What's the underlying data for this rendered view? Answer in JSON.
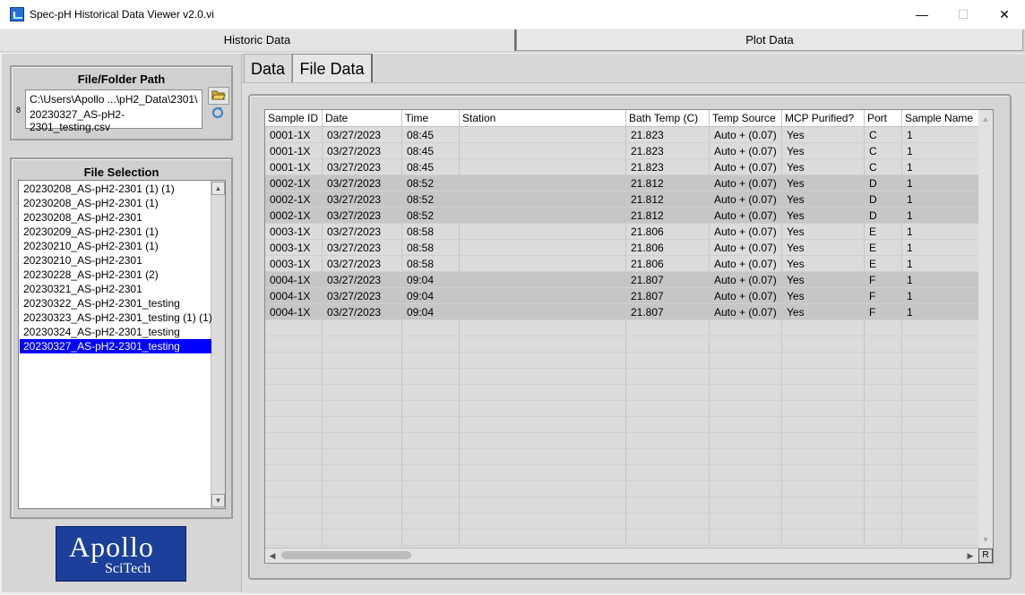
{
  "window": {
    "title": "Spec-pH Historical Data Viewer v2.0.vi",
    "minimize_glyph": "—",
    "maximize_glyph": "☐",
    "close_glyph": "✕"
  },
  "main_tabs": [
    {
      "label": "Historic Data",
      "active": true
    },
    {
      "label": "Plot Data",
      "active": false
    }
  ],
  "file_path": {
    "title": "File/Folder Path",
    "line1": "C:\\Users\\Apollo ...\\pH2_Data\\2301\\",
    "line2": "20230327_AS-pH2-2301_testing.csv",
    "indicator": "8",
    "browse_icon": "folder-open-icon",
    "refresh_icon": "refresh-icon"
  },
  "file_selection": {
    "title": "File Selection",
    "items": [
      "20230208_AS-pH2-2301 (1) (1)",
      "20230208_AS-pH2-2301 (1)",
      "20230208_AS-pH2-2301",
      "20230209_AS-pH2-2301 (1)",
      "20230210_AS-pH2-2301 (1)",
      "20230210_AS-pH2-2301",
      "20230228_AS-pH2-2301 (2)",
      "20230321_AS-pH2-2301",
      "20230322_AS-pH2-2301_testing",
      "20230323_AS-pH2-2301_testing (1) (1)",
      "20230324_AS-pH2-2301_testing",
      "20230327_AS-pH2-2301_testing"
    ],
    "selected_index": 11
  },
  "logo": {
    "line1": "Apollo",
    "line2": "SciTech"
  },
  "sub_tabs": [
    {
      "label": "Data",
      "active": false
    },
    {
      "label": "File Data",
      "active": true
    }
  ],
  "table": {
    "columns": [
      "Sample ID",
      "Date",
      "Time",
      "Station",
      "Bath Temp (C)",
      "Temp Source",
      "MCP Purified?",
      "Port",
      "Sample Name"
    ],
    "rows": [
      [
        "0001-1X",
        "03/27/2023",
        "08:45",
        "",
        "21.823",
        "Auto + (0.07)",
        "Yes",
        "C",
        "1"
      ],
      [
        "0001-1X",
        "03/27/2023",
        "08:45",
        "",
        "21.823",
        "Auto + (0.07)",
        "Yes",
        "C",
        "1"
      ],
      [
        "0001-1X",
        "03/27/2023",
        "08:45",
        "",
        "21.823",
        "Auto + (0.07)",
        "Yes",
        "C",
        "1"
      ],
      [
        "0002-1X",
        "03/27/2023",
        "08:52",
        "",
        "21.812",
        "Auto + (0.07)",
        "Yes",
        "D",
        "1"
      ],
      [
        "0002-1X",
        "03/27/2023",
        "08:52",
        "",
        "21.812",
        "Auto + (0.07)",
        "Yes",
        "D",
        "1"
      ],
      [
        "0002-1X",
        "03/27/2023",
        "08:52",
        "",
        "21.812",
        "Auto + (0.07)",
        "Yes",
        "D",
        "1"
      ],
      [
        "0003-1X",
        "03/27/2023",
        "08:58",
        "",
        "21.806",
        "Auto + (0.07)",
        "Yes",
        "E",
        "1"
      ],
      [
        "0003-1X",
        "03/27/2023",
        "08:58",
        "",
        "21.806",
        "Auto + (0.07)",
        "Yes",
        "E",
        "1"
      ],
      [
        "0003-1X",
        "03/27/2023",
        "08:58",
        "",
        "21.806",
        "Auto + (0.07)",
        "Yes",
        "E",
        "1"
      ],
      [
        "0004-1X",
        "03/27/2023",
        "09:04",
        "",
        "21.807",
        "Auto + (0.07)",
        "Yes",
        "F",
        "1"
      ],
      [
        "0004-1X",
        "03/27/2023",
        "09:04",
        "",
        "21.807",
        "Auto + (0.07)",
        "Yes",
        "F",
        "1"
      ],
      [
        "0004-1X",
        "03/27/2023",
        "09:04",
        "",
        "21.807",
        "Auto + (0.07)",
        "Yes",
        "F",
        "1"
      ]
    ],
    "row_colors": {
      "light": "#dcdcdc",
      "dark": "#c6c6c6"
    },
    "r_button": "R"
  }
}
